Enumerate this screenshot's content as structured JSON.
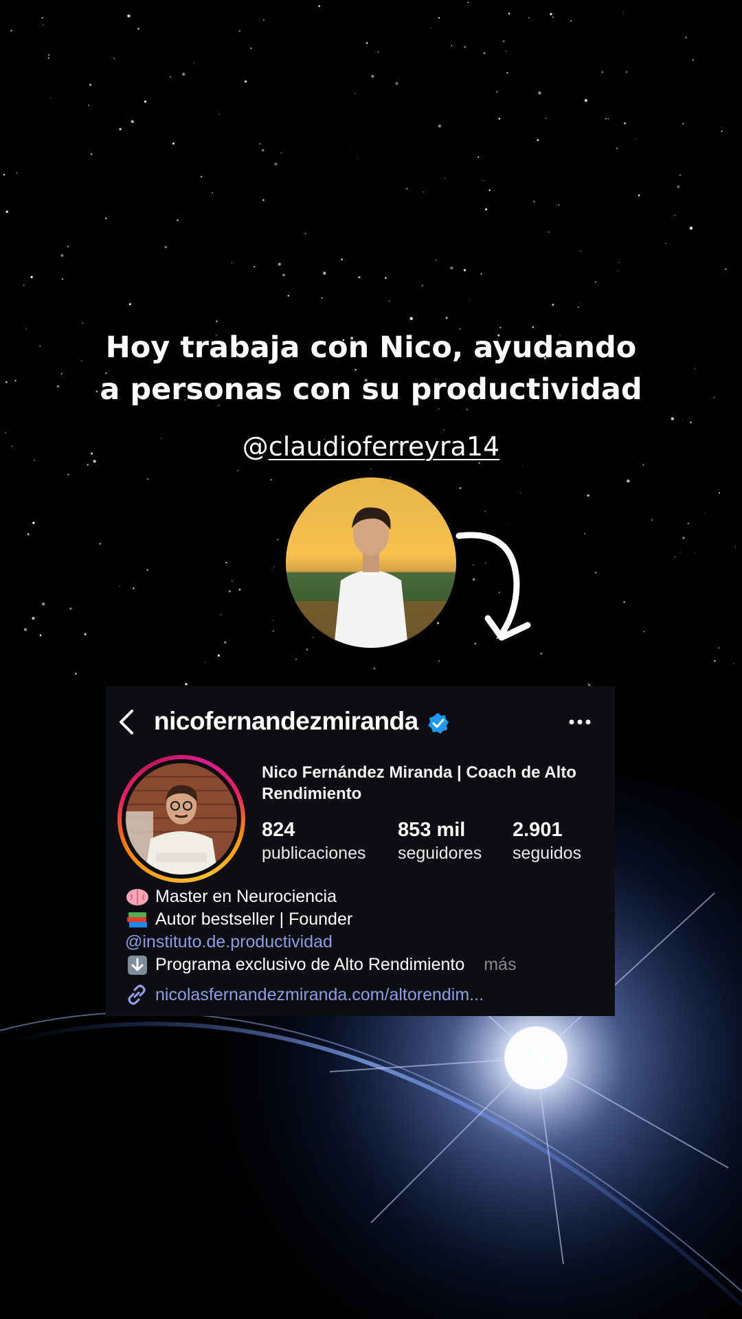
{
  "overlay": {
    "headline_line1": "Hoy trabaja con Nico, ayudando",
    "headline_line2": "a personas con su productividad",
    "handle_at": "@",
    "handle_name": "claudioferreyra14"
  },
  "profile": {
    "username": "nicofernandezmiranda",
    "full_name": "Nico Fernández Miranda | Coach de Alto Rendimiento",
    "stats": [
      {
        "value": "824",
        "label": "publicaciones"
      },
      {
        "value": "853 mil",
        "label": "seguidores"
      },
      {
        "value": "2.901",
        "label": "seguidos"
      }
    ],
    "bio": {
      "line1": "Master en Neurociencia",
      "line2": "Autor bestseller | Founder",
      "mention": "@instituto.de.productividad",
      "line4": "Programa exclusivo de Alto Rendimiento",
      "more": "más",
      "link": "nicolasfernandezmiranda.com/altorendim..."
    }
  },
  "icons": {
    "back": "chevron-left-icon",
    "verified": "verified-badge-icon",
    "more": "more-options-icon",
    "link": "link-icon",
    "bio_emoji_1": "brain-emoji-icon",
    "bio_emoji_2": "books-emoji-icon",
    "bio_emoji_3": "down-arrow-emoji-icon"
  },
  "colors": {
    "card_bg": "#0c0e12",
    "mention": "#8e9ce8",
    "verified": "#1d9bf0",
    "more_text": "#8a8a8a"
  }
}
